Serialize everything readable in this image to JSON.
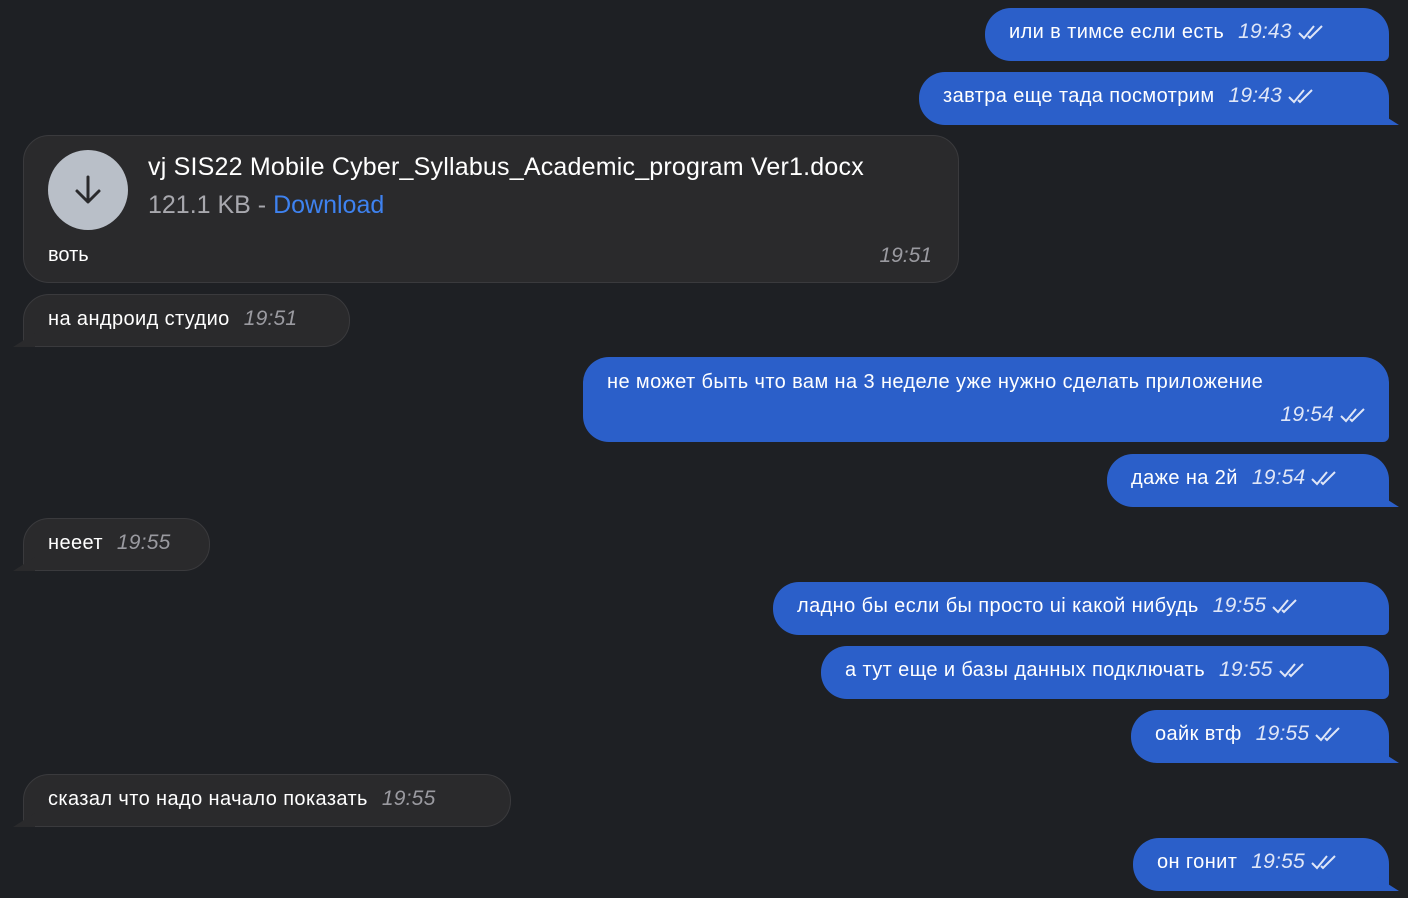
{
  "messages": [
    {
      "direction": "out",
      "text": "или в тимсе если есть",
      "time": "19:43"
    },
    {
      "direction": "out",
      "text": "завтра еще тада посмотрим",
      "time": "19:43"
    },
    {
      "direction": "in",
      "type": "file",
      "file_name": "vj SIS22 Mobile Cyber_Syllabus_Academic_program Ver1.docx",
      "file_size": "121.1 KB",
      "separator": " - ",
      "download_label": "Download",
      "caption": "воть",
      "time": "19:51"
    },
    {
      "direction": "in",
      "text": "на андроид студио",
      "time": "19:51"
    },
    {
      "direction": "out",
      "text": "не может быть что вам на 3 неделе уже нужно сделать приложение",
      "time": "19:54"
    },
    {
      "direction": "out",
      "text": "даже на 2й",
      "time": "19:54"
    },
    {
      "direction": "in",
      "text": "нееет",
      "time": "19:55"
    },
    {
      "direction": "out",
      "text": "ладно бы если бы просто ui какой нибудь",
      "time": "19:55"
    },
    {
      "direction": "out",
      "text": "а тут еще и базы данных подключать",
      "time": "19:55"
    },
    {
      "direction": "out",
      "text": "оайк втф",
      "time": "19:55"
    },
    {
      "direction": "in",
      "text": "сказал что надо начало показать",
      "time": "19:55"
    },
    {
      "direction": "out",
      "text": "он гонит",
      "time": "19:55"
    }
  ],
  "colors": {
    "background": "#1e2024",
    "outgoing_bubble": "#2b5fc9",
    "incoming_bubble": "#2a2a2c",
    "link": "#3e82f0"
  },
  "icons": {
    "download": "download-arrow-icon",
    "read_receipt": "double-check-icon"
  }
}
